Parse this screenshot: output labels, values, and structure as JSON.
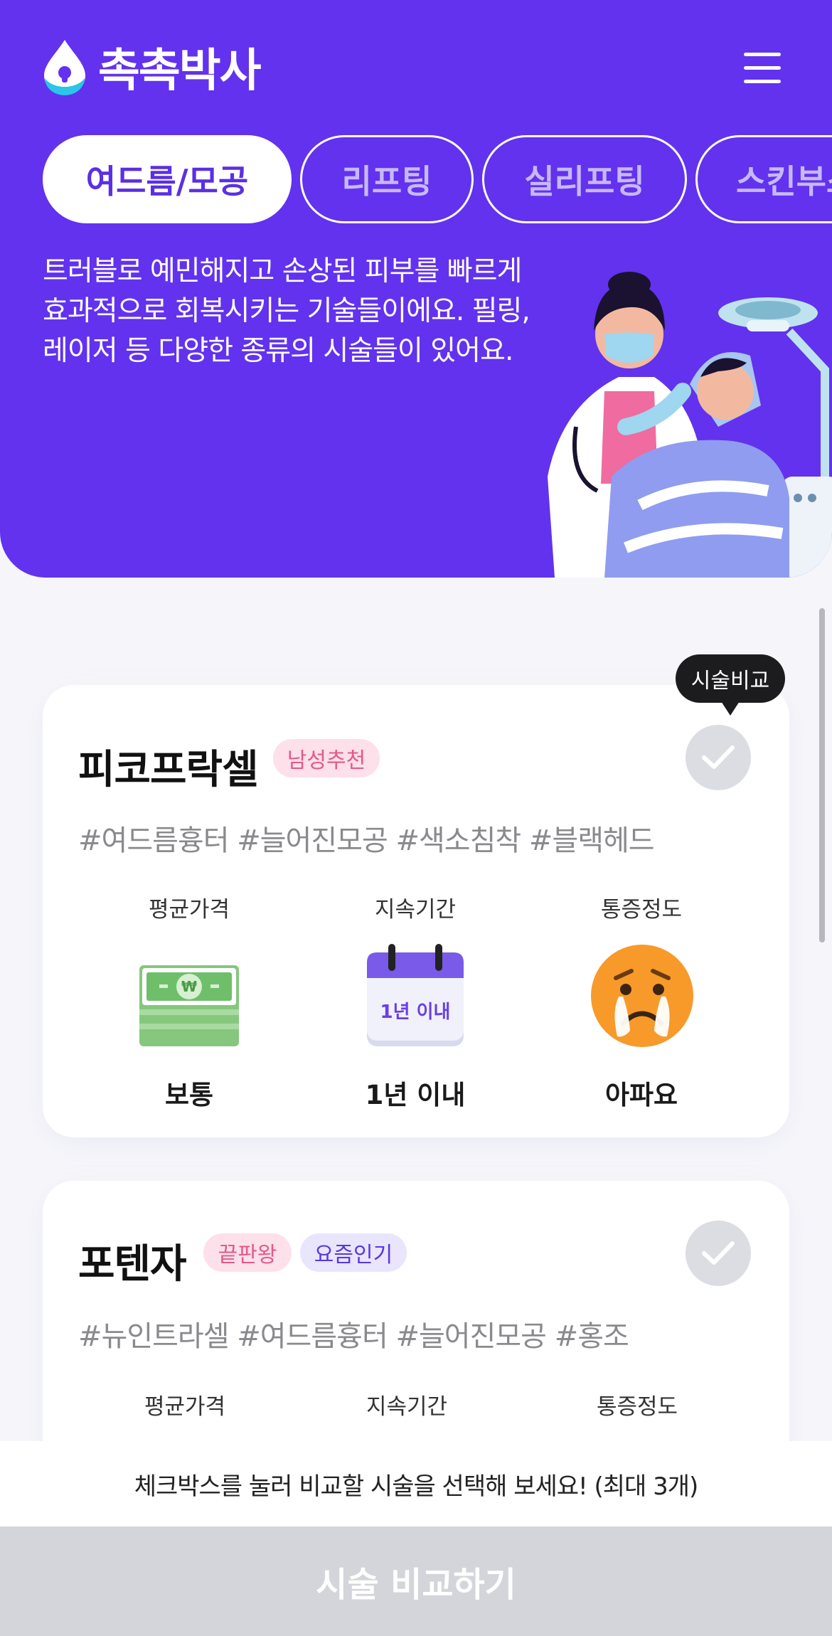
{
  "header": {
    "logo_text": "촉촉박사",
    "menu_icon": "hamburger-menu-icon"
  },
  "tabs": [
    {
      "label": "여드름/모공",
      "active": true
    },
    {
      "label": "리프팅",
      "active": false
    },
    {
      "label": "실리프팅",
      "active": false
    },
    {
      "label": "스킨부스터",
      "active": false
    }
  ],
  "hero": {
    "description": "트러블로 예민해지고 손상된 피부를 빠르게 효과적으로 회복시키는 기술들이에요. 필링, 레이저 등 다양한 종류의 시술들이 있어요."
  },
  "tooltip": "시술비교",
  "cards": [
    {
      "title": "피코프락셀",
      "badges": [
        "남성추천"
      ],
      "tags": "#여드름흉터 #늘어진모공 #색소침착 #블랙헤드",
      "stats": [
        {
          "label": "평균가격",
          "value": "보통",
          "icon": "money-bill-icon"
        },
        {
          "label": "지속기간",
          "value": "1년 이내",
          "icon": "calendar-icon",
          "icon_text": "1년 이내"
        },
        {
          "label": "통증정도",
          "value": "아파요",
          "icon": "crying-face-icon"
        }
      ]
    },
    {
      "title": "포텐자",
      "badges": [
        "끝판왕",
        "요즘인기"
      ],
      "tags": "#뉴인트라셀 #여드름흉터 #늘어진모공 #홍조",
      "stats": [
        {
          "label": "평균가격"
        },
        {
          "label": "지속기간"
        },
        {
          "label": "통증정도"
        }
      ]
    }
  ],
  "footer": {
    "hint": "체크박스를 눌러 비교할 시술을 선택해 보세요! (최대 3개)",
    "compare_button": "시술 비교하기"
  },
  "colors": {
    "brand_purple": "#6232ee",
    "badge_pink_bg": "#fde0ea",
    "badge_lilac_bg": "#e9e5fd",
    "disabled_button": "#d4d5db"
  }
}
